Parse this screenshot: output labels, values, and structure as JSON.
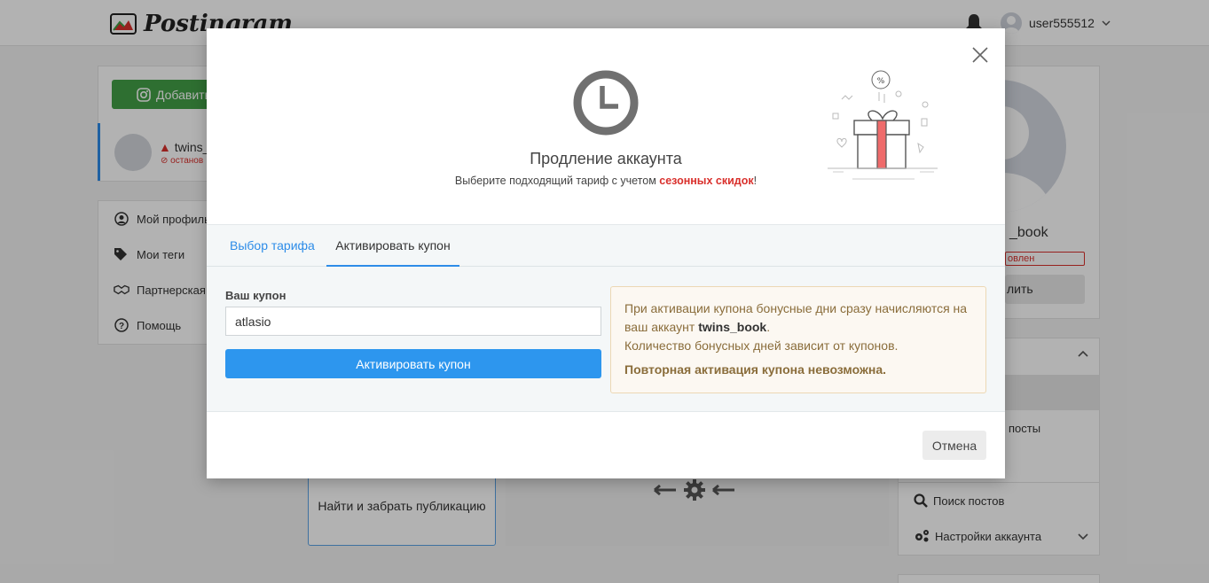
{
  "app": {
    "logo_text": "Postingram"
  },
  "header": {
    "username": "user555512"
  },
  "sidebar": {
    "add_button": "Добавить",
    "account": {
      "name": "twins_",
      "status": "останов"
    },
    "nav": [
      {
        "label": "Мой профиль",
        "icon": "user-circle-icon"
      },
      {
        "label": "Мои теги",
        "icon": "tags-icon"
      },
      {
        "label": "Партнерская",
        "icon": "handshake-icon"
      },
      {
        "label": "Помощь",
        "icon": "question-icon"
      }
    ]
  },
  "main": {
    "find_card_text": "Найти и забрать публикацию"
  },
  "right_panel": {
    "name": "_book",
    "status": "овлен",
    "button": "лить",
    "menu_text": "посты",
    "menu_items": [
      {
        "label": "Поиск постов",
        "icon": "search-icon"
      },
      {
        "label": "Настройки аккаунта",
        "icon": "gears-icon"
      }
    ]
  },
  "modal": {
    "title": "Продление аккаунта",
    "subtitle_before": "Выберите подходящий тариф с учетом ",
    "subtitle_highlight": "сезонных скидок",
    "subtitle_after": "!",
    "tabs": [
      {
        "label": "Выбор тарифа",
        "active": false
      },
      {
        "label": "Активировать купон",
        "active": true
      }
    ],
    "coupon": {
      "label": "Ваш купон",
      "value": "atlasio",
      "button": "Активировать купон"
    },
    "info": {
      "line1_before": "При активации купона бонусные дни сразу начисляются на ваш аккаунт ",
      "account": "twins_book",
      "line1_after": ".",
      "line2": "Количество бонусных дней зависит от купонов.",
      "warning": "Повторная активация купона невозможна."
    },
    "cancel_button": "Отмена"
  },
  "colors": {
    "accent": "#2d8ce8",
    "primary_button": "#2d96ee",
    "danger": "#d9302c",
    "add_button": "#43a047"
  }
}
